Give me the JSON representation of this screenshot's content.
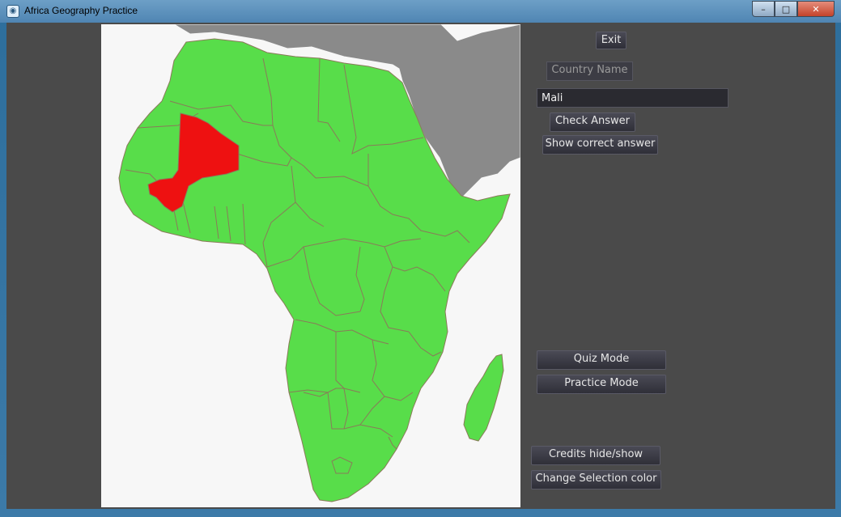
{
  "window": {
    "title": "Africa Geography Practice",
    "controls": {
      "minimize": "–",
      "maximize": "□",
      "close": "✕"
    }
  },
  "sidebar": {
    "exit_label": "Exit",
    "country_name_label": "Country Name",
    "answer_input_value": "Mali",
    "check_answer_label": "Check Answer",
    "show_correct_label": "Show correct answer",
    "quiz_mode_label": "Quiz Mode",
    "practice_mode_label": "Practice Mode",
    "credits_label": "Credits hide/show",
    "change_color_label": "Change Selection color"
  },
  "map": {
    "selected_country": "Mali",
    "colors": {
      "land": "#58dd4a",
      "selected": "#ee1111",
      "other_land": "#8a8a8a",
      "sea": "#f7f7f7",
      "border": "#8a7a5a"
    }
  }
}
